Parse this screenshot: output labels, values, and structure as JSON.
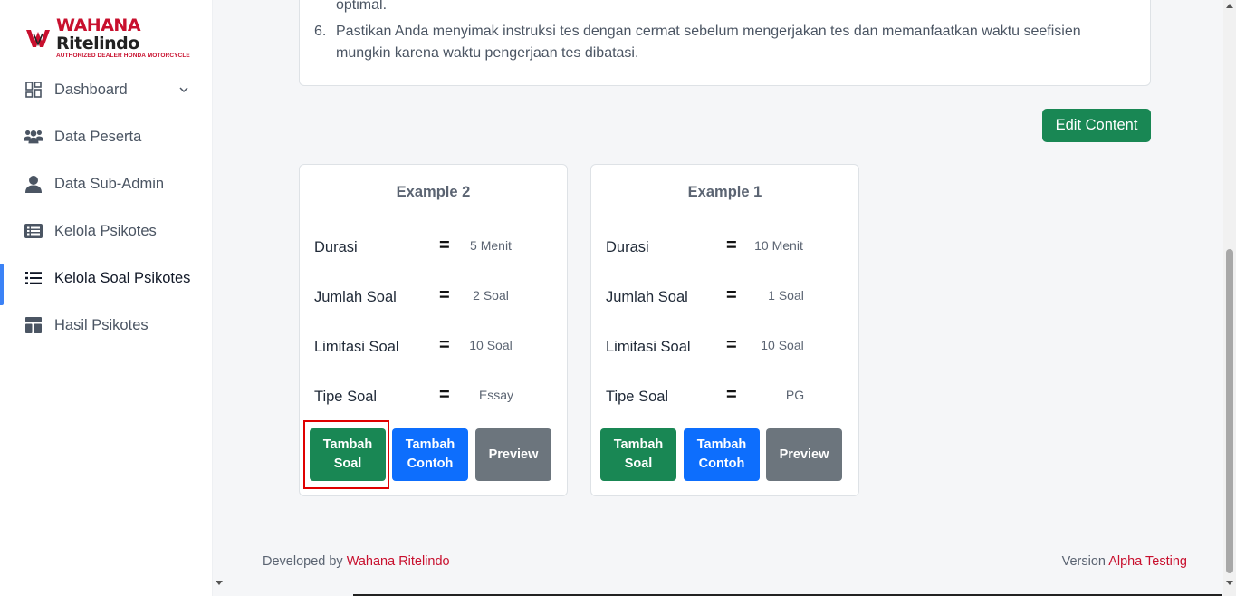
{
  "logo": {
    "brand_main": "WAHANA",
    "brand_second": "Ritelindo",
    "tagline": "AUTHORIZED DEALER HONDA MOTORCYCLE"
  },
  "sidebar": {
    "items": [
      {
        "label": "Dashboard",
        "icon": "dashboard-grid-icon",
        "has_chevron": true
      },
      {
        "label": "Data Peserta",
        "icon": "users-group-icon"
      },
      {
        "label": "Data Sub-Admin",
        "icon": "user-icon"
      },
      {
        "label": "Kelola Psikotes",
        "icon": "list-box-icon"
      },
      {
        "label": "Kelola Soal Psikotes",
        "icon": "list-icon",
        "active": true
      },
      {
        "label": "Hasil Psikotes",
        "icon": "layout-icon"
      }
    ]
  },
  "instructions": {
    "partial_text": "optimal.",
    "item_number": "6.",
    "item_text": "Pastikan Anda menyimak instruksi tes dengan cermat sebelum mengerjakan tes dan memanfaatkan waktu seefisien mungkin karena waktu pengerjaan tes dibatasi."
  },
  "edit_button": "Edit Content",
  "cards": [
    {
      "title": "Example 2",
      "rows": [
        {
          "label": "Durasi",
          "value": "5 Menit"
        },
        {
          "label": "Jumlah Soal",
          "value": "2 Soal"
        },
        {
          "label": "Limitasi Soal",
          "value": "10 Soal"
        },
        {
          "label": "Tipe Soal",
          "value": "Essay"
        }
      ],
      "buttons": {
        "add_question": "Tambah Soal",
        "add_example": "Tambah Contoh",
        "preview": "Preview"
      }
    },
    {
      "title": "Example 1",
      "rows": [
        {
          "label": "Durasi",
          "value": "10 Menit"
        },
        {
          "label": "Jumlah Soal",
          "value": "1 Soal"
        },
        {
          "label": "Limitasi Soal",
          "value": "10 Soal"
        },
        {
          "label": "Tipe Soal",
          "value": "PG"
        }
      ],
      "buttons": {
        "add_question": "Tambah Soal",
        "add_example": "Tambah Contoh",
        "preview": "Preview"
      }
    }
  ],
  "eq_sign": "=",
  "footer": {
    "developed_prefix": "Developed by",
    "developed_by": "Wahana Ritelindo",
    "version_prefix": "Version",
    "version": "Alpha Testing"
  },
  "colors": {
    "brand_red": "#c8102e",
    "green": "#198754",
    "blue": "#0d6efd",
    "gray": "#6c757d",
    "active_indicator": "#3b82f6",
    "highlight": "#e00000"
  }
}
